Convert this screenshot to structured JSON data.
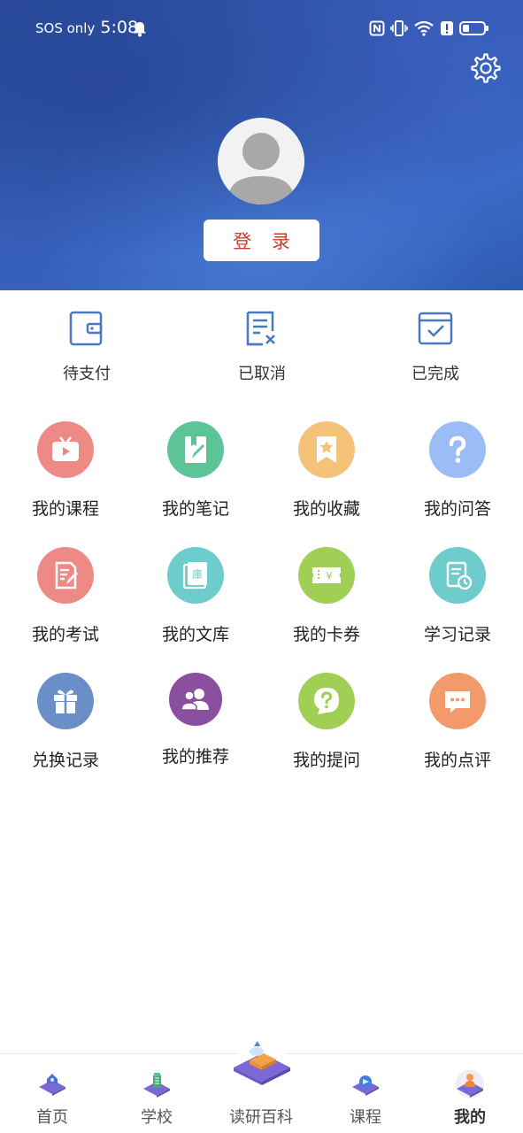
{
  "status_bar": {
    "carrier": "SOS only",
    "time": "5:08"
  },
  "header": {
    "login_label": "登 录"
  },
  "orders": [
    {
      "label": "待支付",
      "icon": "wallet-icon"
    },
    {
      "label": "已取消",
      "icon": "cancelled-document-icon"
    },
    {
      "label": "已完成",
      "icon": "completed-check-icon"
    }
  ],
  "grid": [
    {
      "label": "我的课程",
      "icon": "tv-play-icon",
      "color": "#ee8a86"
    },
    {
      "label": "我的笔记",
      "icon": "notebook-pen-icon",
      "color": "#5cc496"
    },
    {
      "label": "我的收藏",
      "icon": "bookmark-star-icon",
      "color": "#f5c27a"
    },
    {
      "label": "我的问答",
      "icon": "question-mark-icon",
      "color": "#9bbcf6"
    },
    {
      "label": "我的考试",
      "icon": "exam-paper-icon",
      "color": "#ee8a86"
    },
    {
      "label": "我的文库",
      "icon": "library-book-icon",
      "color": "#6ecccd"
    },
    {
      "label": "我的卡券",
      "icon": "coupon-ticket-icon",
      "color": "#a0cf55"
    },
    {
      "label": "学习记录",
      "icon": "study-record-clock-icon",
      "color": "#6ecccd"
    },
    {
      "label": "兑换记录",
      "icon": "gift-box-icon",
      "color": "#6a8fc8"
    },
    {
      "label": "我的推荐",
      "icon": "users-recommend-icon",
      "color": "#8a4f9e"
    },
    {
      "label": "我的提问",
      "icon": "question-bubble-icon",
      "color": "#a0cf55"
    },
    {
      "label": "我的点评",
      "icon": "comment-bubble-icon",
      "color": "#f39a6c"
    }
  ],
  "bottom_nav": [
    {
      "label": "首页",
      "icon": "home-cube-icon"
    },
    {
      "label": "学校",
      "icon": "school-cube-icon"
    },
    {
      "label": "读研百科",
      "icon": "encyclopedia-cube-icon"
    },
    {
      "label": "课程",
      "icon": "course-cube-icon"
    },
    {
      "label": "我的",
      "icon": "profile-cube-icon",
      "active": true
    }
  ],
  "colors": {
    "login_text": "#d03a2a",
    "order_icon": "#4a78c0"
  }
}
